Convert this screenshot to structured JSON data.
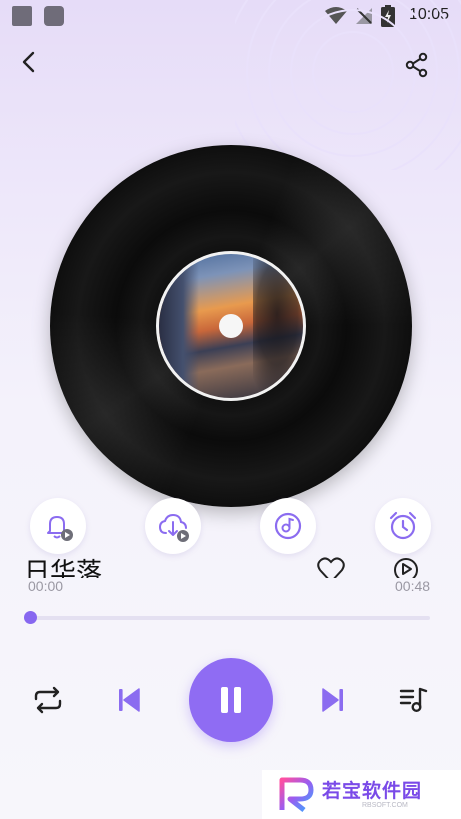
{
  "status_bar": {
    "time": "10:05"
  },
  "song": {
    "title": "日华落"
  },
  "progress": {
    "current": "00:00",
    "total": "00:48",
    "fraction": 0.0
  },
  "icons": {
    "back": "back-arrow-icon",
    "share": "share-icon",
    "ringtone": "bell-play-icon",
    "download": "cloud-download-icon",
    "disc": "music-disc-icon",
    "timer": "alarm-clock-icon",
    "favorite": "heart-icon",
    "video": "play-circle-icon",
    "repeat": "repeat-icon",
    "previous": "skip-previous-icon",
    "pause": "pause-icon",
    "next": "skip-next-icon",
    "playlist": "playlist-icon"
  },
  "colors": {
    "accent": "#8f6cf3",
    "icon_purple": "#8b6cf0",
    "text": "#111111",
    "muted": "#9a98a3"
  },
  "watermark": {
    "text": "若宝软件园",
    "sub": "RBSOFT.COM"
  }
}
